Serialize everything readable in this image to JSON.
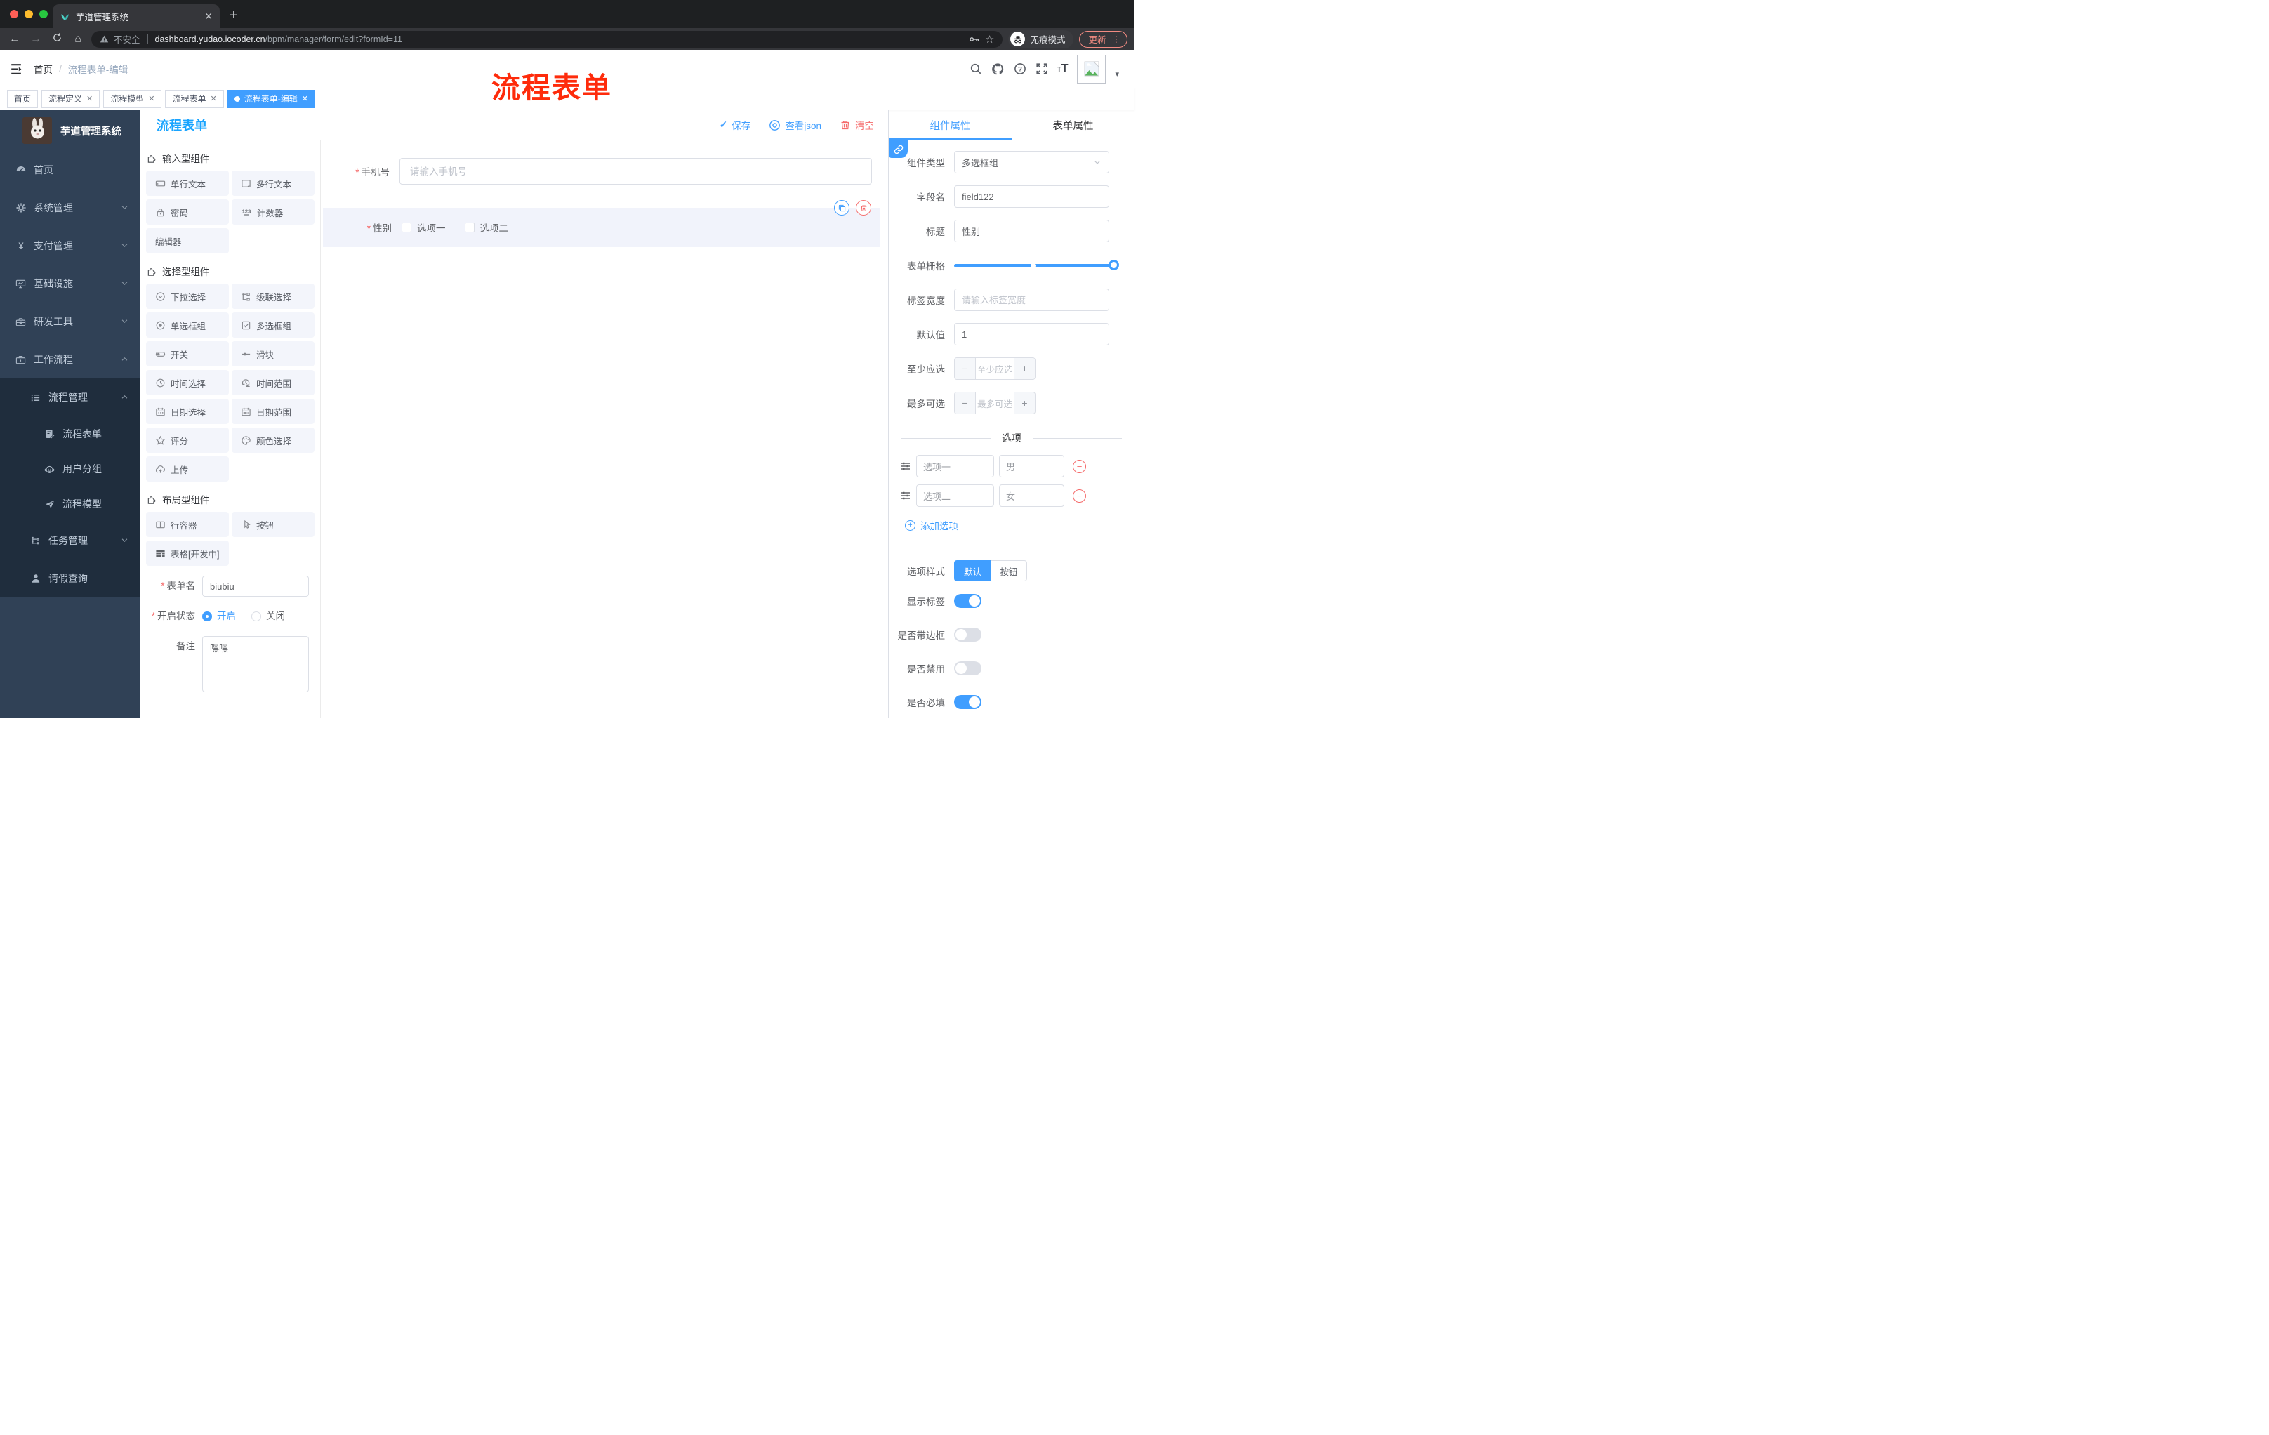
{
  "browser": {
    "tab_title": "芋道管理系统",
    "security_label": "不安全",
    "url_host": "dashboard.yudao.iocoder.cn",
    "url_path": "/bpm/manager/form/edit?formId=11",
    "incognito_label": "无痕模式",
    "update_label": "更新"
  },
  "header": {
    "breadcrumb_home": "首页",
    "breadcrumb_current": "流程表单-编辑",
    "overlay_title": "流程表单"
  },
  "tabbar": {
    "tabs": [
      {
        "label": "首页",
        "closable": false,
        "active": false
      },
      {
        "label": "流程定义",
        "closable": true,
        "active": false
      },
      {
        "label": "流程模型",
        "closable": true,
        "active": false
      },
      {
        "label": "流程表单",
        "closable": true,
        "active": false
      },
      {
        "label": "流程表单-编辑",
        "closable": true,
        "active": true
      }
    ]
  },
  "sidebar": {
    "logo_title": "芋道管理系统",
    "menu": [
      {
        "label": "首页",
        "icon": "dashboard",
        "level": 1,
        "chevron": "",
        "sub": false
      },
      {
        "label": "系统管理",
        "icon": "gear",
        "level": 1,
        "chevron": "down",
        "sub": false
      },
      {
        "label": "支付管理",
        "icon": "yen",
        "level": 1,
        "chevron": "down",
        "sub": false
      },
      {
        "label": "基础设施",
        "icon": "monitor",
        "level": 1,
        "chevron": "down",
        "sub": false
      },
      {
        "label": "研发工具",
        "icon": "toolbox",
        "level": 1,
        "chevron": "down",
        "sub": false
      },
      {
        "label": "工作流程",
        "icon": "briefcase",
        "level": 1,
        "chevron": "up",
        "sub": false
      },
      {
        "label": "流程管理",
        "icon": "listtree",
        "level": 2,
        "chevron": "up",
        "sub": true
      },
      {
        "label": "流程表单",
        "icon": "formdoc",
        "level": 3,
        "chevron": "",
        "sub": true
      },
      {
        "label": "用户分组",
        "icon": "robot",
        "level": 3,
        "chevron": "",
        "sub": true
      },
      {
        "label": "流程模型",
        "icon": "send",
        "level": 3,
        "chevron": "",
        "sub": true
      },
      {
        "label": "任务管理",
        "icon": "tasktree",
        "level": 2,
        "chevron": "down",
        "sub": true
      },
      {
        "label": "请假查询",
        "icon": "person",
        "level": 2,
        "chevron": "",
        "sub": true
      }
    ]
  },
  "work": {
    "panel_title": "流程表单",
    "save_label": "保存",
    "view_json_label": "查看json",
    "clear_label": "清空"
  },
  "palette": {
    "sections": [
      {
        "title": "输入型组件",
        "items": [
          {
            "label": "单行文本",
            "icon": "input"
          },
          {
            "label": "多行文本",
            "icon": "textarea"
          },
          {
            "label": "密码",
            "icon": "lock"
          },
          {
            "label": "计数器",
            "icon": "counter"
          },
          {
            "label": "编辑器",
            "icon": ""
          }
        ]
      },
      {
        "title": "选择型组件",
        "items": [
          {
            "label": "下拉选择",
            "icon": "select"
          },
          {
            "label": "级联选择",
            "icon": "cascade"
          },
          {
            "label": "单选框组",
            "icon": "radio"
          },
          {
            "label": "多选框组",
            "icon": "checkbox"
          },
          {
            "label": "开关",
            "icon": "switch"
          },
          {
            "label": "滑块",
            "icon": "slider"
          },
          {
            "label": "时间选择",
            "icon": "clock"
          },
          {
            "label": "时间范围",
            "icon": "clockrange"
          },
          {
            "label": "日期选择",
            "icon": "calendar"
          },
          {
            "label": "日期范围",
            "icon": "calendarrange"
          },
          {
            "label": "评分",
            "icon": "star"
          },
          {
            "label": "颜色选择",
            "icon": "palette"
          },
          {
            "label": "上传",
            "icon": "upload"
          }
        ]
      },
      {
        "title": "布局型组件",
        "items": [
          {
            "label": "行容器",
            "icon": "rowcol"
          },
          {
            "label": "按钮",
            "icon": "pointer"
          },
          {
            "label": "表格[开发中]",
            "icon": "tablegrid"
          }
        ]
      }
    ]
  },
  "left_form": {
    "form_name_label": "表单名",
    "form_name_value": "biubiu",
    "status_label": "开启状态",
    "status_options": [
      "开启",
      "关闭"
    ],
    "status_selected": "开启",
    "remark_label": "备注",
    "remark_value": "嘿嘿"
  },
  "canvas": {
    "phone_label": "手机号",
    "phone_placeholder": "请输入手机号",
    "gender_label": "性别",
    "gender_options": [
      "选项一",
      "选项二"
    ]
  },
  "right_panel": {
    "tab_component": "组件属性",
    "tab_form": "表单属性",
    "component_type_label": "组件类型",
    "component_type_value": "多选框组",
    "field_name_label": "字段名",
    "field_name_value": "field122",
    "title_label": "标题",
    "title_value": "性别",
    "grid_label": "表单栅格",
    "label_width_label": "标签宽度",
    "label_width_placeholder": "请输入标签宽度",
    "default_label": "默认值",
    "default_value": "1",
    "min_label": "至少应选",
    "min_placeholder": "至少应选",
    "max_label": "最多可选",
    "max_placeholder": "最多可选",
    "options_title": "选项",
    "options": [
      {
        "label": "选项一",
        "value": "男"
      },
      {
        "label": "选项二",
        "value": "女"
      }
    ],
    "add_option_label": "添加选项",
    "style_label": "选项样式",
    "style_options": [
      "默认",
      "按钮"
    ],
    "style_selected": "默认",
    "switches": [
      {
        "label": "显示标签",
        "on": true
      },
      {
        "label": "是否带边框",
        "on": false
      },
      {
        "label": "是否禁用",
        "on": false
      },
      {
        "label": "是否必填",
        "on": true
      }
    ]
  },
  "colors": {
    "primary": "#409eff",
    "danger": "#f56c6c",
    "annotation_red": "#fe2b0b",
    "sidebar_bg": "#304156",
    "sidebar_submenu_bg": "#1f2d3d",
    "chip_bg": "#f3f5fb",
    "selected_block_bg": "#f1f3fb",
    "update_button": "#f28b82"
  }
}
